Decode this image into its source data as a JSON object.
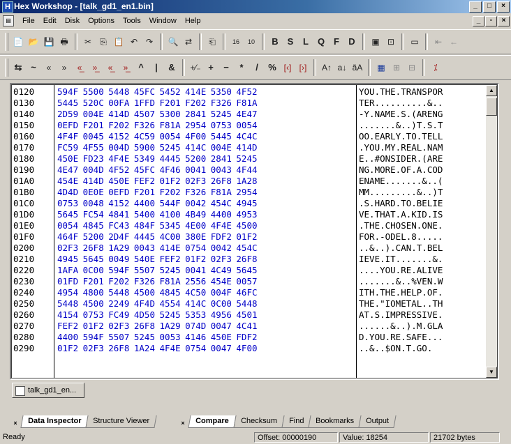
{
  "window": {
    "title": "Hex Workshop - [talk_gd1_en1.bin]",
    "app_icon": "H"
  },
  "menu": [
    "File",
    "Edit",
    "Disk",
    "Options",
    "Tools",
    "Window",
    "Help"
  ],
  "toolbar1": {
    "icons": [
      "new-file-icon",
      "open-folder-icon",
      "save-icon",
      "print-icon",
      "cut-icon",
      "copy-icon",
      "paste-icon",
      "undo-icon",
      "redo-icon",
      "find-icon",
      "replace-icon",
      "goto-icon",
      "hex-base-16-icon",
      "hex-base-10-icon"
    ],
    "text_buttons": [
      "B",
      "S",
      "L",
      "Q",
      "F",
      "D"
    ],
    "right_icons": [
      "checksum-icon",
      "compare-icon",
      "window-icon",
      "back-icon",
      "forward-icon"
    ]
  },
  "toolbar2": {
    "buttons": [
      "⇆",
      "~",
      "«",
      "»",
      "«̲",
      "»̲",
      "«̲",
      "»̲",
      "^",
      "|",
      "&",
      "+⁄₋",
      "+",
      "−",
      "*",
      "/",
      "%",
      "[‹]",
      "[›]",
      "A↑",
      "a↓",
      "a͂A"
    ],
    "right_icons": [
      "grid-icon",
      "layout-icon",
      "layout2-icon",
      "cross-icon"
    ]
  },
  "hex": {
    "rows": [
      {
        "addr": "0120",
        "bytes": "594F 5500 5448 45FC 5452 414E 5350 4F52",
        "ascii": "YOU.THE.TRANSPOR"
      },
      {
        "addr": "0130",
        "bytes": "5445 520C 00FA 1FFD F201 F202 F326 F81A",
        "ascii": "TER..........&.."
      },
      {
        "addr": "0140",
        "bytes": "2D59 004E 414D 4507 5300 2841 5245 4E47",
        "ascii": "-Y.NAME.S.(ARENG"
      },
      {
        "addr": "0150",
        "bytes": "0EFD F201 F202 F326 F81A 2954 0753 0054",
        "ascii": ".......&..)T.S.T"
      },
      {
        "addr": "0160",
        "bytes": "4F4F 0045 4152 4C59 0054 4F00 5445 4C4C",
        "ascii": "OO.EARLY.TO.TELL"
      },
      {
        "addr": "0170",
        "bytes": "FC59 4F55 004D 5900 5245 414C 004E 414D",
        "ascii": ".YOU.MY.REAL.NAM"
      },
      {
        "addr": "0180",
        "bytes": "450E FD23 4F4E 5349 4445 5200 2841 5245",
        "ascii": "E..#ONSIDER.(ARE"
      },
      {
        "addr": "0190",
        "bytes": "4E47 004D 4F52 45FC 4F46 0041 0043 4F44",
        "ascii": "NG.MORE.OF.A.COD"
      },
      {
        "addr": "01A0",
        "bytes": "454E 414D 450E FEF2 01F2 02F3 26F8 1A28",
        "ascii": "ENAME.......&..("
      },
      {
        "addr": "01B0",
        "bytes": "4D4D 0E0E 0EFD F201 F202 F326 F81A 2954",
        "ascii": "MM.........&..)T"
      },
      {
        "addr": "01C0",
        "bytes": "0753 0048 4152 4400 544F 0042 454C 4945",
        "ascii": ".S.HARD.TO.BELIE"
      },
      {
        "addr": "01D0",
        "bytes": "5645 FC54 4841 5400 4100 4B49 4400 4953",
        "ascii": "VE.THAT.A.KID.IS"
      },
      {
        "addr": "01E0",
        "bytes": "0054 4845 FC43 484F 5345 4E00 4F4E 4500",
        "ascii": ".THE.CHOSEN.ONE."
      },
      {
        "addr": "01F0",
        "bytes": "464F 5200 2D4F 4445 4C00 380E FDF2 01F2",
        "ascii": "FOR.-ODEL.8....."
      },
      {
        "addr": "0200",
        "bytes": "02F3 26F8 1A29 0043 414E 0754 0042 454C",
        "ascii": "..&..).CAN.T.BEL"
      },
      {
        "addr": "0210",
        "bytes": "4945 5645 0049 540E FEF2 01F2 02F3 26F8",
        "ascii": "IEVE.IT.......&."
      },
      {
        "addr": "0220",
        "bytes": "1AFA 0C00 594F 5507 5245 0041 4C49 5645",
        "ascii": "....YOU.RE.ALIVE"
      },
      {
        "addr": "0230",
        "bytes": "01FD F201 F202 F326 F81A 2556 454E 0057",
        "ascii": ".......&..%VEN.W"
      },
      {
        "addr": "0240",
        "bytes": "4954 4800 5448 4500 4845 4C50 004F 46FC",
        "ascii": "ITH.THE.HELP.OF."
      },
      {
        "addr": "0250",
        "bytes": "5448 4500 2249 4F4D 4554 414C 0C00 5448",
        "ascii": "THE.\"IOMETAL..TH"
      },
      {
        "addr": "0260",
        "bytes": "4154 0753 FC49 4D50 5245 5353 4956 4501",
        "ascii": "AT.S.IMPRESSIVE."
      },
      {
        "addr": "0270",
        "bytes": "FEF2 01F2 02F3 26F8 1A29 074D 0047 4C41",
        "ascii": "......&..).M.GLA"
      },
      {
        "addr": "0280",
        "bytes": "4400 594F 5507 5245 0053 4146 450E FDF2",
        "ascii": "D.YOU.RE.SAFE..."
      },
      {
        "addr": "0290",
        "bytes": "01F2 02F3 26F8 1A24 4F4E 0754 0047 4F00",
        "ascii": "..&..$ON.T.GO."
      }
    ]
  },
  "doc_tab": "talk_gd1_en...",
  "left_pane_tabs": [
    "Data Inspector",
    "Structure Viewer"
  ],
  "right_pane_tabs": [
    "Compare",
    "Checksum",
    "Find",
    "Bookmarks",
    "Output"
  ],
  "status": {
    "ready": "Ready",
    "offset": "Offset: 00000190",
    "value": "Value: 18254",
    "size": "21702 bytes"
  }
}
